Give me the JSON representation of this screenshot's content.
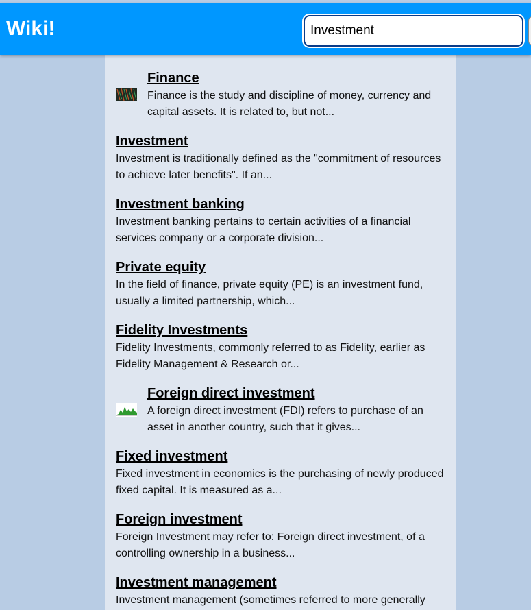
{
  "header": {
    "logo": "Wiki!",
    "search_value": "Investment"
  },
  "results": [
    {
      "title": "Finance",
      "snippet": "Finance is the study and discipline of money, currency and capital assets. It is related to, but not..."
    },
    {
      "title": "Investment",
      "snippet": "Investment is traditionally defined as the \"commitment of resources to achieve later benefits\". If an..."
    },
    {
      "title": "Investment banking",
      "snippet": "Investment banking pertains to certain activities of a financial services company or a corporate division..."
    },
    {
      "title": "Private equity",
      "snippet": "In the field of finance, private equity (PE) is an investment fund, usually a limited partnership, which..."
    },
    {
      "title": "Fidelity Investments",
      "snippet": "Fidelity Investments, commonly referred to as Fidelity, earlier as Fidelity Management & Research or..."
    },
    {
      "title": "Foreign direct investment",
      "snippet": "A foreign direct investment (FDI) refers to purchase of an asset in another country, such that it gives..."
    },
    {
      "title": "Fixed investment",
      "snippet": "Fixed investment in economics is the purchasing of newly produced fixed capital. It is measured as a..."
    },
    {
      "title": "Foreign investment",
      "snippet": "Foreign Investment may refer to: Foreign direct investment, of a controlling ownership in a business..."
    },
    {
      "title": "Investment management",
      "snippet": "Investment management (sometimes referred to more generally"
    }
  ]
}
